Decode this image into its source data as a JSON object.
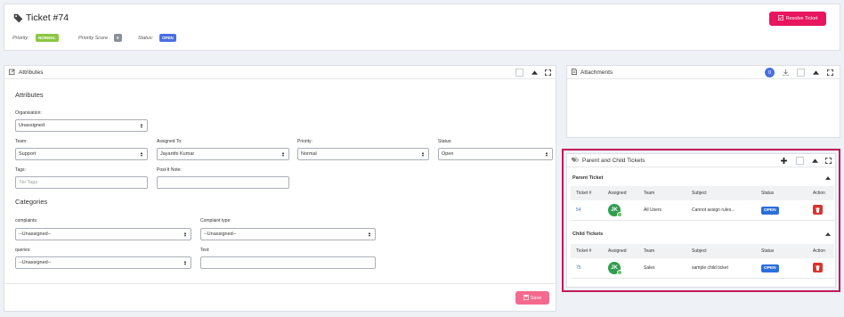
{
  "header": {
    "title": "Ticket #74",
    "priority_label": "Priority:",
    "priority_value": "NORMAL",
    "score_label": "Priority Score",
    "score_value": "0",
    "status_label": "Status:",
    "status_value": "OPEN",
    "resolve_button": "Resolve Ticket"
  },
  "attributes": {
    "panel_title": "Attributes",
    "section_title": "Attributes",
    "organisation": {
      "label": "Organisation:",
      "value": "Unassigned"
    },
    "team": {
      "label": "Team:",
      "value": "Support"
    },
    "assigned_to": {
      "label": "Assigned To:",
      "value": "Jayanthi Kumar"
    },
    "priority": {
      "label": "Priority:",
      "value": "Normal"
    },
    "status": {
      "label": "Status:",
      "value": "Open"
    },
    "tags": {
      "label": "Tags:",
      "placeholder": "No Tags"
    },
    "postit": {
      "label": "Post-It Note:",
      "value": ""
    },
    "categories_title": "Categories",
    "complaints": {
      "label": "complaints:",
      "value": "--Unassigned--"
    },
    "complaint_type": {
      "label": "Complaint type:",
      "value": "--Unassigned--"
    },
    "queries": {
      "label": "queries:",
      "value": "--Unassigned--"
    },
    "test": {
      "label": "Test:",
      "value": ""
    },
    "save_button": "Save"
  },
  "attachments": {
    "panel_title": "Attachments",
    "count": "0"
  },
  "parent_child": {
    "panel_title": "Parent and Child Tickets",
    "parent_section": "Parent Ticket",
    "child_section": "Child Tickets",
    "columns": [
      "Ticket #",
      "Assigned",
      "Team",
      "Subject",
      "Status",
      "Action"
    ],
    "parent_row": {
      "ticket": "54",
      "initials": "JK",
      "team": "All Users",
      "subject": "Cannot assign rules...",
      "status": "OPEN"
    },
    "child_row": {
      "ticket": "75",
      "initials": "JK",
      "team": "Sales",
      "subject": "sample child ticket",
      "status": "OPEN"
    }
  },
  "colors": {
    "accent": "#e8155f",
    "normal_badge": "#8cc63f",
    "open_badge": "#4a6fe3",
    "highlight_border": "#c2185b"
  }
}
